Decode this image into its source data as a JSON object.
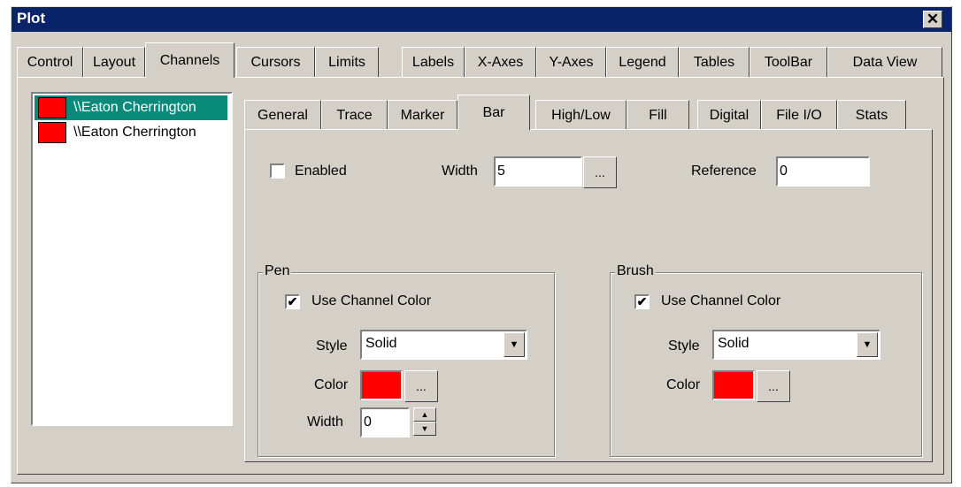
{
  "window": {
    "title": "Plot",
    "close_glyph": "✕"
  },
  "main_tabs": [
    "Control",
    "Layout",
    "Channels",
    "Cursors",
    "Limits",
    "Labels",
    "X-Axes",
    "Y-Axes",
    "Legend",
    "Tables",
    "ToolBar",
    "Data View"
  ],
  "main_active_tab": "Channels",
  "channels": [
    {
      "name": "\\\\Eaton Cherrington",
      "color": "#ff0000",
      "selected": true
    },
    {
      "name": "\\\\Eaton Cherrington",
      "color": "#ff0000",
      "selected": false
    }
  ],
  "sub_tabs": [
    "General",
    "Trace",
    "Marker",
    "Bar",
    "High/Low",
    "Fill",
    "Digital",
    "File I/O",
    "Stats"
  ],
  "sub_active_tab": "Bar",
  "bar": {
    "enabled_label": "Enabled",
    "enabled": false,
    "width_label": "Width",
    "width_value": "5",
    "ellipsis": "...",
    "reference_label": "Reference",
    "reference_value": "0"
  },
  "pen": {
    "group_label": "Pen",
    "use_channel_color_label": "Use Channel Color",
    "use_channel_color": true,
    "style_label": "Style",
    "style_value": "Solid",
    "color_label": "Color",
    "color_value": "#ff0000",
    "ellipsis": "...",
    "width_label": "Width",
    "width_value": "0"
  },
  "brush": {
    "group_label": "Brush",
    "use_channel_color_label": "Use Channel Color",
    "use_channel_color": true,
    "style_label": "Style",
    "style_value": "Solid",
    "color_label": "Color",
    "color_value": "#ff0000",
    "ellipsis": "..."
  },
  "glyphs": {
    "check": "✔",
    "dropdown": "▼",
    "spin_up": "▲",
    "spin_down": "▼"
  }
}
